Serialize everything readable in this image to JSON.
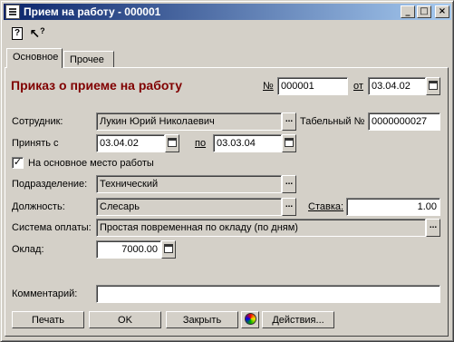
{
  "window": {
    "title": "Прием на работу - 000001"
  },
  "titlebar_buttons": [
    "_",
    "□",
    "×"
  ],
  "toolbar": {
    "help_label": "?",
    "whatsthis_label": "?"
  },
  "tabs": [
    {
      "label": "Основное"
    },
    {
      "label": "Прочее"
    }
  ],
  "form": {
    "heading": "Приказ о приеме на работу",
    "number_label": "№",
    "number_value": "000001",
    "date_from_label": "от",
    "date_value": "03.04.02",
    "employee_label": "Сотрудник:",
    "employee_value": "Лукин Юрий Николаевич",
    "tab_number_label": "Табельный №",
    "tab_number_value": "0000000027",
    "hire_from_label": "Принять с",
    "hire_from_value": "03.04.02",
    "hire_to_label": "по",
    "hire_to_value": "03.03.04",
    "main_job_label": "На основное место работы",
    "main_job_checked": true,
    "department_label": "Подразделение:",
    "department_value": "Технический",
    "position_label": "Должность:",
    "position_value": "Слесарь",
    "rate_label": "Ставка:",
    "rate_value": "1.00",
    "pay_system_label": "Система оплаты:",
    "pay_system_value": "Простая повременная по окладу (по дням)",
    "salary_label": "Оклад:",
    "salary_value": "7000.00",
    "comment_label": "Комментарий:",
    "comment_value": ""
  },
  "buttons": {
    "print": "Печать",
    "ok": "OK",
    "close": "Закрыть",
    "actions": "Действия..."
  },
  "colors": {
    "title_start": "#0a246a",
    "title_end": "#a6caf0",
    "heading": "#800000",
    "face": "#d4d0c8"
  }
}
